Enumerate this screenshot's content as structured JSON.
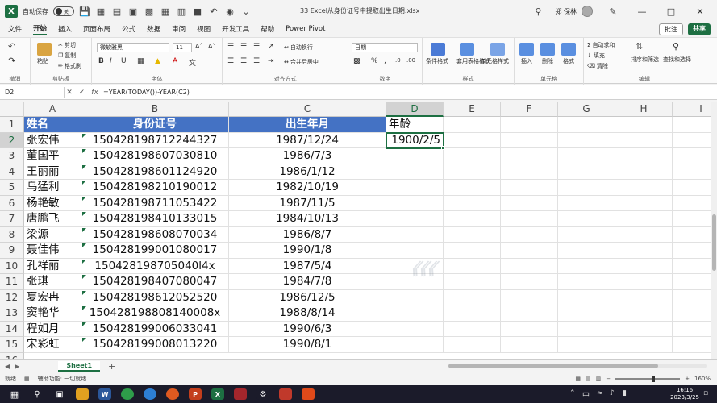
{
  "titlebar": {
    "autosave_label": "自动保存",
    "autosave_state": "关",
    "document_title": "33 Excel从身份证号中提取出生日期.xlsx",
    "user_name": "郑 保林"
  },
  "ribbon_tabs": [
    "文件",
    "开始",
    "插入",
    "页面布局",
    "公式",
    "数据",
    "审阅",
    "视图",
    "开发工具",
    "帮助",
    "Power Pivot"
  ],
  "active_tab": "开始",
  "actions": {
    "comment": "批注",
    "share": "共享"
  },
  "ribbon": {
    "undo_group": "撤消",
    "clipboard": {
      "label": "剪贴板",
      "paste": "粘贴",
      "cut": "剪切",
      "copy": "复制",
      "format_painter": "格式刷"
    },
    "font": {
      "label": "字体",
      "name": "微软雅黑",
      "size": "11"
    },
    "alignment": {
      "label": "对齐方式",
      "wrap": "自动换行",
      "merge": "合并后居中"
    },
    "number": {
      "label": "数字",
      "format": "日期"
    },
    "styles": {
      "label": "样式",
      "conditional": "条件格式",
      "table": "套用表格格式",
      "cell_styles": "单元格样式"
    },
    "cells": {
      "label": "单元格",
      "insert": "插入",
      "delete": "删除",
      "format": "格式"
    },
    "editing": {
      "label": "编辑",
      "autosum": "自动求和",
      "fill": "填充",
      "clear": "清除",
      "sort": "排序和筛选",
      "find": "查找和选择"
    }
  },
  "formula_bar": {
    "name_box": "D2",
    "formula": "=YEAR(TODAY())-YEAR(C2)"
  },
  "columns": [
    "A",
    "B",
    "C",
    "D",
    "E",
    "F",
    "G",
    "H",
    "I"
  ],
  "selected_column": "D",
  "selected_row": "2",
  "headers": {
    "name": "姓名",
    "id": "身份证号",
    "birth": "出生年月",
    "age": "年龄"
  },
  "rows": [
    {
      "row": "2",
      "name": "张宏伟",
      "id": "150428198712244327",
      "birth": "1987/12/24",
      "age": "1900/2/5"
    },
    {
      "row": "3",
      "name": "董国平",
      "id": "150428198607030810",
      "birth": "1986/7/3",
      "age": ""
    },
    {
      "row": "4",
      "name": "王丽丽",
      "id": "150428198601124920",
      "birth": "1986/1/12",
      "age": ""
    },
    {
      "row": "5",
      "name": "乌猛利",
      "id": "150428198210190012",
      "birth": "1982/10/19",
      "age": ""
    },
    {
      "row": "6",
      "name": "杨艳敏",
      "id": "150428198711053422",
      "birth": "1987/11/5",
      "age": ""
    },
    {
      "row": "7",
      "name": "唐鹏飞",
      "id": "150428198410133015",
      "birth": "1984/10/13",
      "age": ""
    },
    {
      "row": "8",
      "name": "梁源",
      "id": "150428198608070034",
      "birth": "1986/8/7",
      "age": ""
    },
    {
      "row": "9",
      "name": "聂佳伟",
      "id": "150428199001080017",
      "birth": "1990/1/8",
      "age": ""
    },
    {
      "row": "10",
      "name": "孔祥丽",
      "id": "150428198705040l4x",
      "birth": "1987/5/4",
      "age": ""
    },
    {
      "row": "11",
      "name": "张琪",
      "id": "150428198407080047",
      "birth": "1984/7/8",
      "age": ""
    },
    {
      "row": "12",
      "name": "夏宏冉",
      "id": "150428198612052520",
      "birth": "1986/12/5",
      "age": ""
    },
    {
      "row": "13",
      "name": "窦艳华",
      "id": "150428198808140008x",
      "birth": "1988/8/14",
      "age": ""
    },
    {
      "row": "14",
      "name": "程如月",
      "id": "150428199006033041",
      "birth": "1990/6/3",
      "age": ""
    },
    {
      "row": "15",
      "name": "宋彩虹",
      "id": "150428199008013220",
      "birth": "1990/8/1",
      "age": ""
    }
  ],
  "sheet_tab": "Sheet1",
  "status": {
    "ready": "就绪",
    "accessibility": "辅助功能: 一切就绪",
    "zoom": "160%"
  },
  "taskbar": {
    "time": "16:16",
    "date": "2023/3/25"
  },
  "colors": {
    "excel_green": "#1d6f42",
    "header_blue": "#4472c4"
  }
}
